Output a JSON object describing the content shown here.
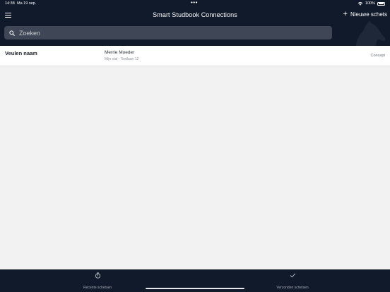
{
  "status_bar": {
    "time": "14:38",
    "date": "Ma 19 sep.",
    "dots": "•••",
    "battery": "100%"
  },
  "header": {
    "title": "Smart Studbook Connections",
    "new_sketch_label": "Nieuwe schets",
    "menu_icon": "hamburger-menu-icon",
    "logo_icon": "horse-head-logo"
  },
  "search": {
    "placeholder": "Zoeken",
    "value": ""
  },
  "list": {
    "items": [
      {
        "foal_name": "Veulen naam",
        "mare_name": "Merrie Moeder",
        "mare_address": "Mijn stal - Testlaan 12",
        "status": "Concept"
      }
    ]
  },
  "tabs": [
    {
      "label": "Recente schetsen",
      "icon": "timer-icon"
    },
    {
      "label": "Verzonden schetsen",
      "icon": "checkmark-icon"
    }
  ],
  "colors": {
    "header_bg": "#111a2b",
    "search_bg": "#3f4756",
    "content_bg": "#f2f2f3",
    "row_bg": "#ffffff"
  }
}
